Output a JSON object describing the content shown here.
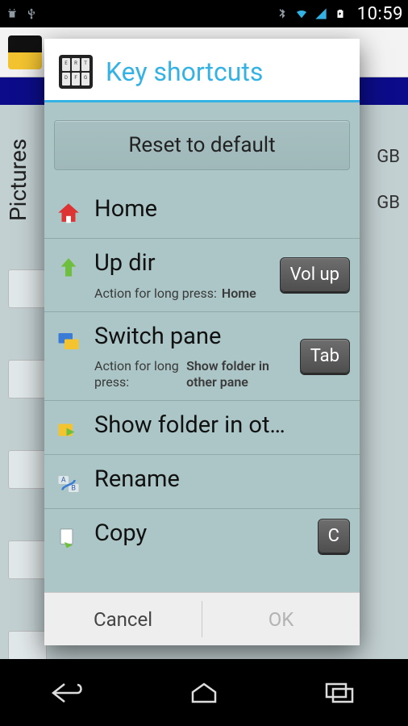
{
  "statusbar": {
    "time": "10:59"
  },
  "background": {
    "tab_text": "Pictures",
    "size_suffix_1": "GB",
    "size_suffix_2": "GB"
  },
  "dialog": {
    "title": "Key shortcuts",
    "reset_label": "Reset to default",
    "long_press_prefix": "Action for long press:",
    "items": [
      {
        "label": "Home",
        "key": null,
        "long_press": null
      },
      {
        "label": "Up dir",
        "key": "Vol up",
        "long_press": "Home"
      },
      {
        "label": "Switch pane",
        "key": "Tab",
        "long_press": "Show folder in other pane"
      },
      {
        "label": "Show folder in ot…",
        "key": null,
        "long_press": null
      },
      {
        "label": "Rename",
        "key": null,
        "long_press": null
      },
      {
        "label": "Copy",
        "key": "C",
        "long_press": null
      }
    ],
    "cancel_label": "Cancel",
    "ok_label": "OK"
  }
}
